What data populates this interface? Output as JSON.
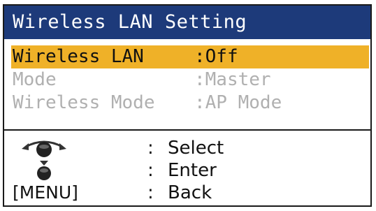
{
  "title": "Wireless LAN Setting",
  "menu": [
    {
      "label": "Wireless LAN",
      "value": ":Off",
      "state": "selected"
    },
    {
      "label": "Mode",
      "value": ":Master",
      "state": "disabled"
    },
    {
      "label": "Wireless Mode",
      "value": ":AP Mode",
      "state": "disabled"
    }
  ],
  "help": [
    {
      "key_icon": "rotary-knob-rotate-icon",
      "colon": ":",
      "action": "Select"
    },
    {
      "key_icon": "rotary-knob-push-icon",
      "colon": ":",
      "action": "Enter"
    },
    {
      "key_text": "[MENU]",
      "colon": ":",
      "action": "Back"
    }
  ],
  "colors": {
    "title_bg": "#1d3a7a",
    "selected_bg": "#efb128",
    "disabled_text": "#b0b0b0"
  }
}
